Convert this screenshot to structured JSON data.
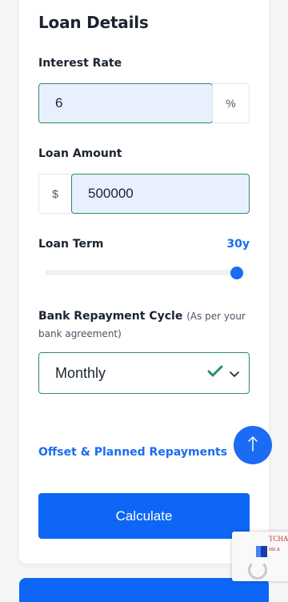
{
  "section": {
    "title": "Loan Details"
  },
  "interest_rate": {
    "label": "Interest Rate",
    "value": "6",
    "suffix": "%"
  },
  "loan_amount": {
    "label": "Loan Amount",
    "prefix": "$",
    "value": "500000"
  },
  "loan_term": {
    "label": "Loan Term",
    "value_label": "30y",
    "fill_fraction": 1.0
  },
  "repayment_cycle": {
    "label": "Bank Repayment Cycle",
    "sublabel": "(As per your bank agreement)",
    "selected": "Monthly",
    "check_icon": "check-icon",
    "chevron_icon": "chevron-down-icon"
  },
  "offset_link": {
    "label": "Offset & Planned Repayments"
  },
  "scroll_top": {
    "icon": "arrow-up-icon"
  },
  "calculate_button": {
    "label": "Calculate"
  },
  "captcha": {
    "text1": "TCHA",
    "text2": "ou a"
  },
  "colors": {
    "accent": "#1a6cf2",
    "success": "#2f8a6c",
    "input_fill": "#e8f0fd"
  }
}
